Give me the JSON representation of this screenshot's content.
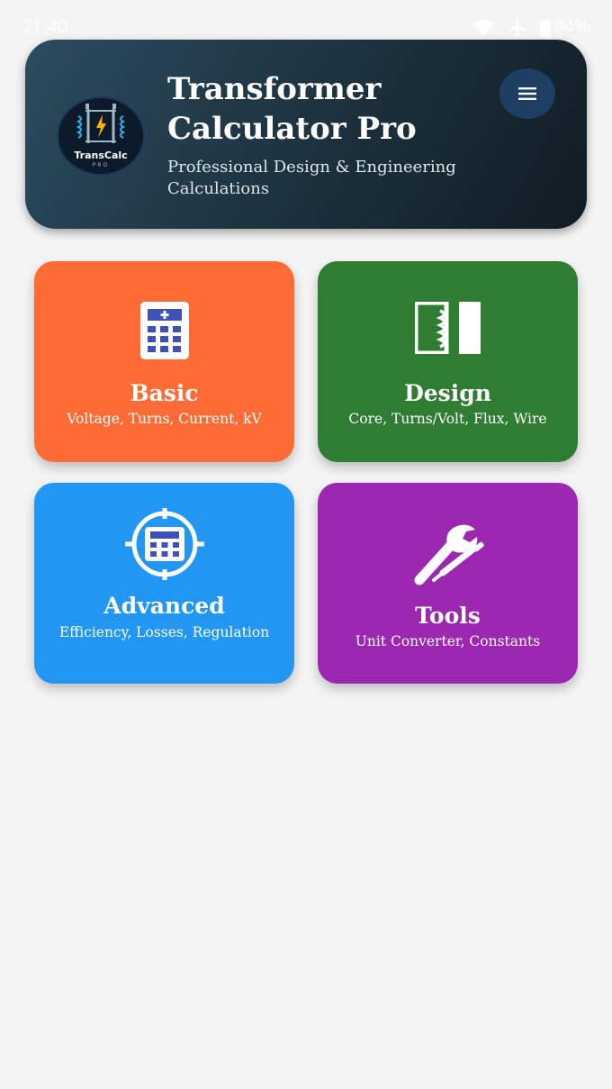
{
  "status_bar": {
    "time": "21:40",
    "battery": "94%",
    "icons": [
      "wifi-icon",
      "airplane-icon",
      "battery-icon"
    ]
  },
  "header": {
    "logo_text": "TransCalc",
    "logo_sub": "PRO",
    "title": "Transformer Calculator Pro",
    "subtitle": "Professional Design & Engineering Calculations",
    "menu_icon": "menu-icon"
  },
  "cards": [
    {
      "title": "Basic",
      "subtitle": "Voltage, Turns, Current, kV",
      "icon": "calculator-icon",
      "color": "#ff6b35"
    },
    {
      "title": "Design",
      "subtitle": "Core, Turns/Volt, Flux, Wire",
      "icon": "transformer-core-icon",
      "color": "#2e7d32"
    },
    {
      "title": "Advanced",
      "subtitle": "Efficiency, Losses, Regulation",
      "icon": "target-calculator-icon",
      "color": "#2196f3"
    },
    {
      "title": "Tools",
      "subtitle": "Unit Converter, Constants",
      "icon": "tools-icon",
      "color": "#9c27b0"
    }
  ]
}
